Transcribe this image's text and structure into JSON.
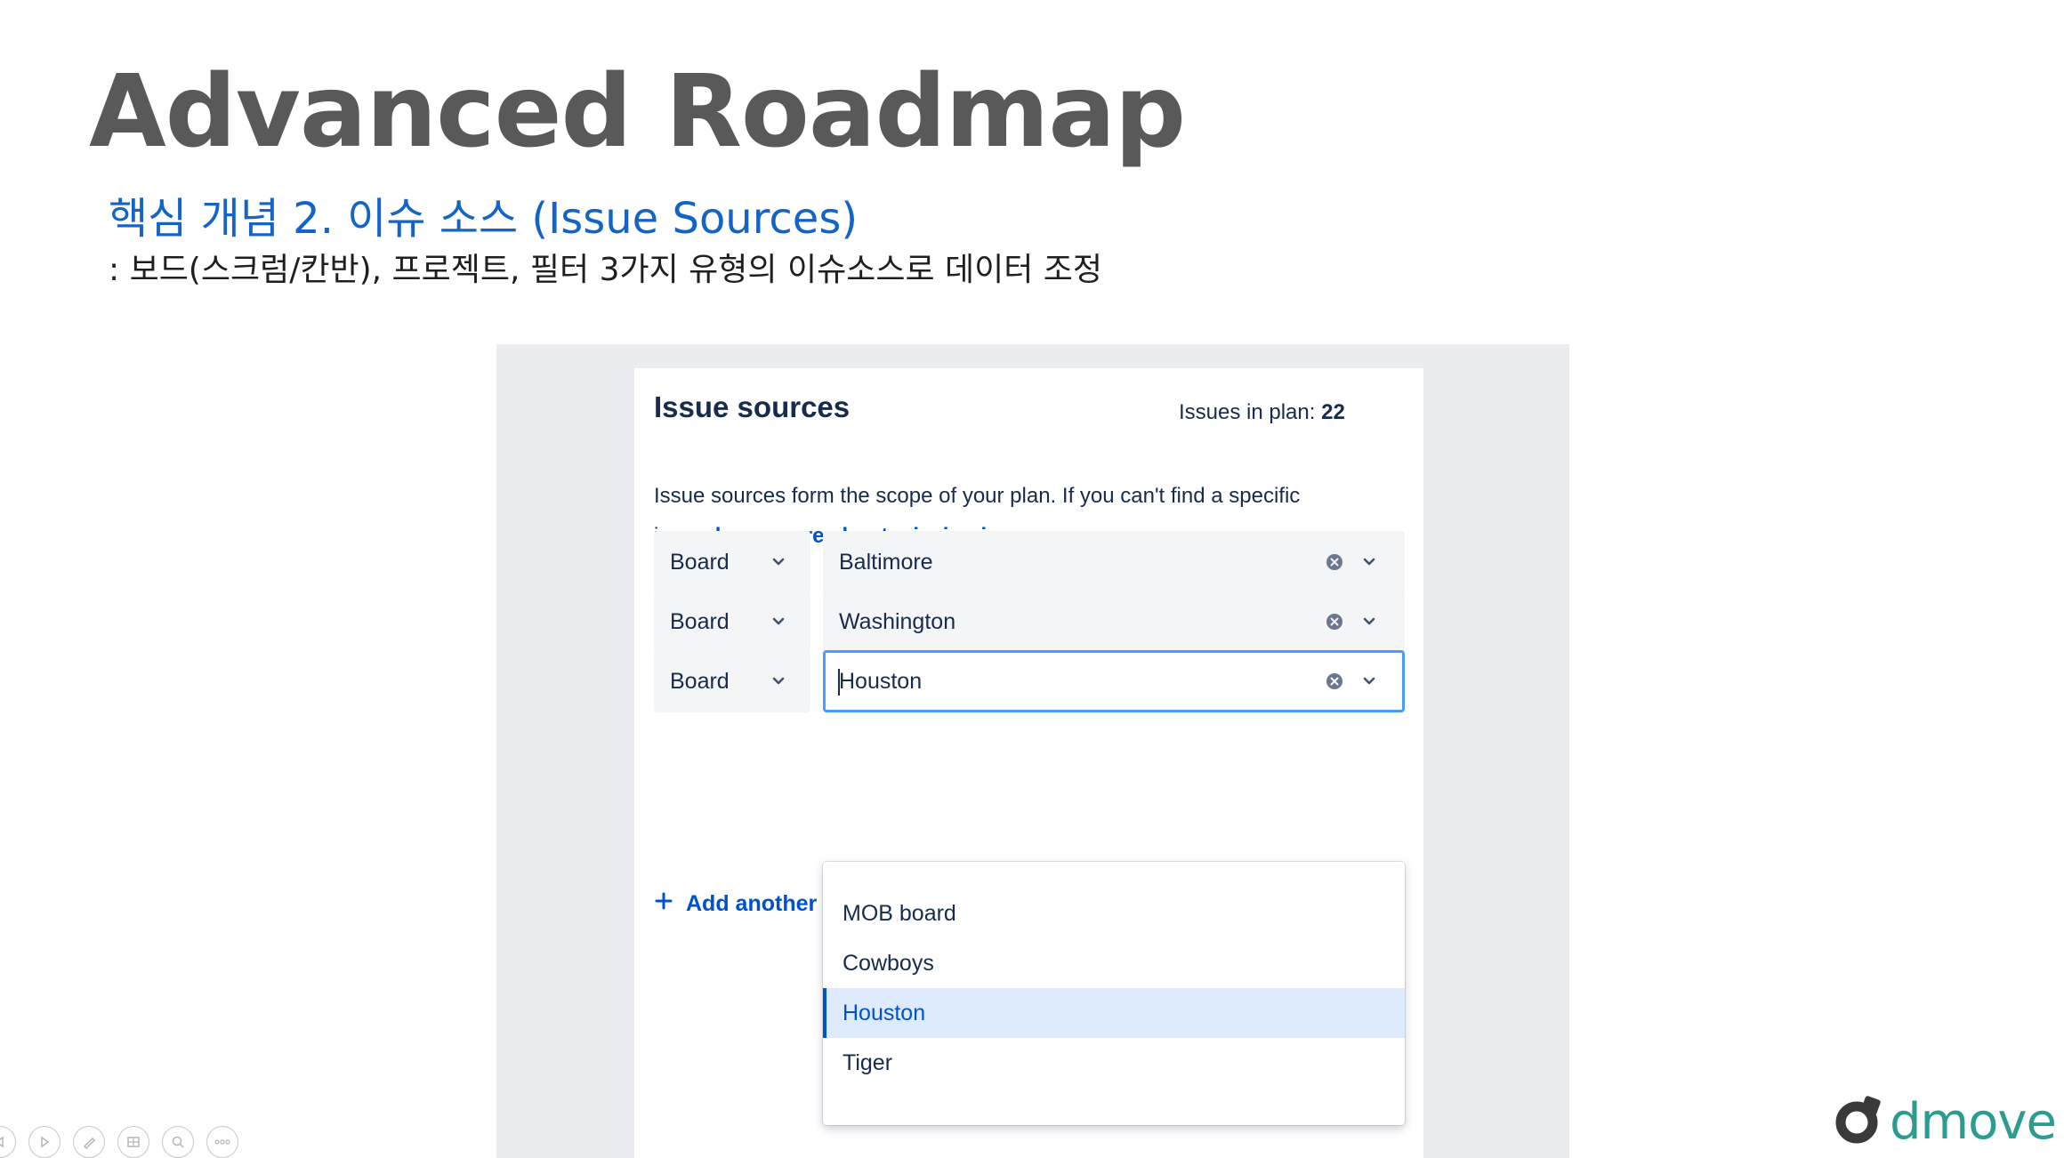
{
  "slide": {
    "title": "Advanced Roadmap",
    "subtitle": "핵심 개념 2. 이슈 소스 (Issue Sources)",
    "description": ": 보드(스크럼/칸반), 프로젝트, 필터 3가지 유형의 이슈소스로 데이터 조정"
  },
  "panel": {
    "title": "Issue sources",
    "issues_label": "Issues in plan:",
    "issues_count": "22",
    "description": "Issue sources form the scope of your plan. If you can't find a specific issue,",
    "link_text": "learn more about missing issues",
    "link_suffix": "."
  },
  "sources": [
    {
      "type": "Board",
      "value": "Baltimore"
    },
    {
      "type": "Board",
      "value": "Washington"
    },
    {
      "type": "Board",
      "value": "Houston"
    }
  ],
  "add_another": "Add another",
  "dropdown": {
    "options": [
      "MOB board",
      "Cowboys",
      "Houston",
      "Tiger"
    ],
    "selected": "Houston"
  },
  "logo": {
    "text": "dmove",
    "color": "#2a9d8f"
  },
  "colors": {
    "accent": "#0052cc",
    "focus": "#4c9aff",
    "title": "#595959",
    "subtitle": "#1464c8"
  },
  "presenter_controls": [
    "previous-icon",
    "next-icon",
    "pen-icon",
    "slides-icon",
    "zoom-icon",
    "more-icon"
  ]
}
